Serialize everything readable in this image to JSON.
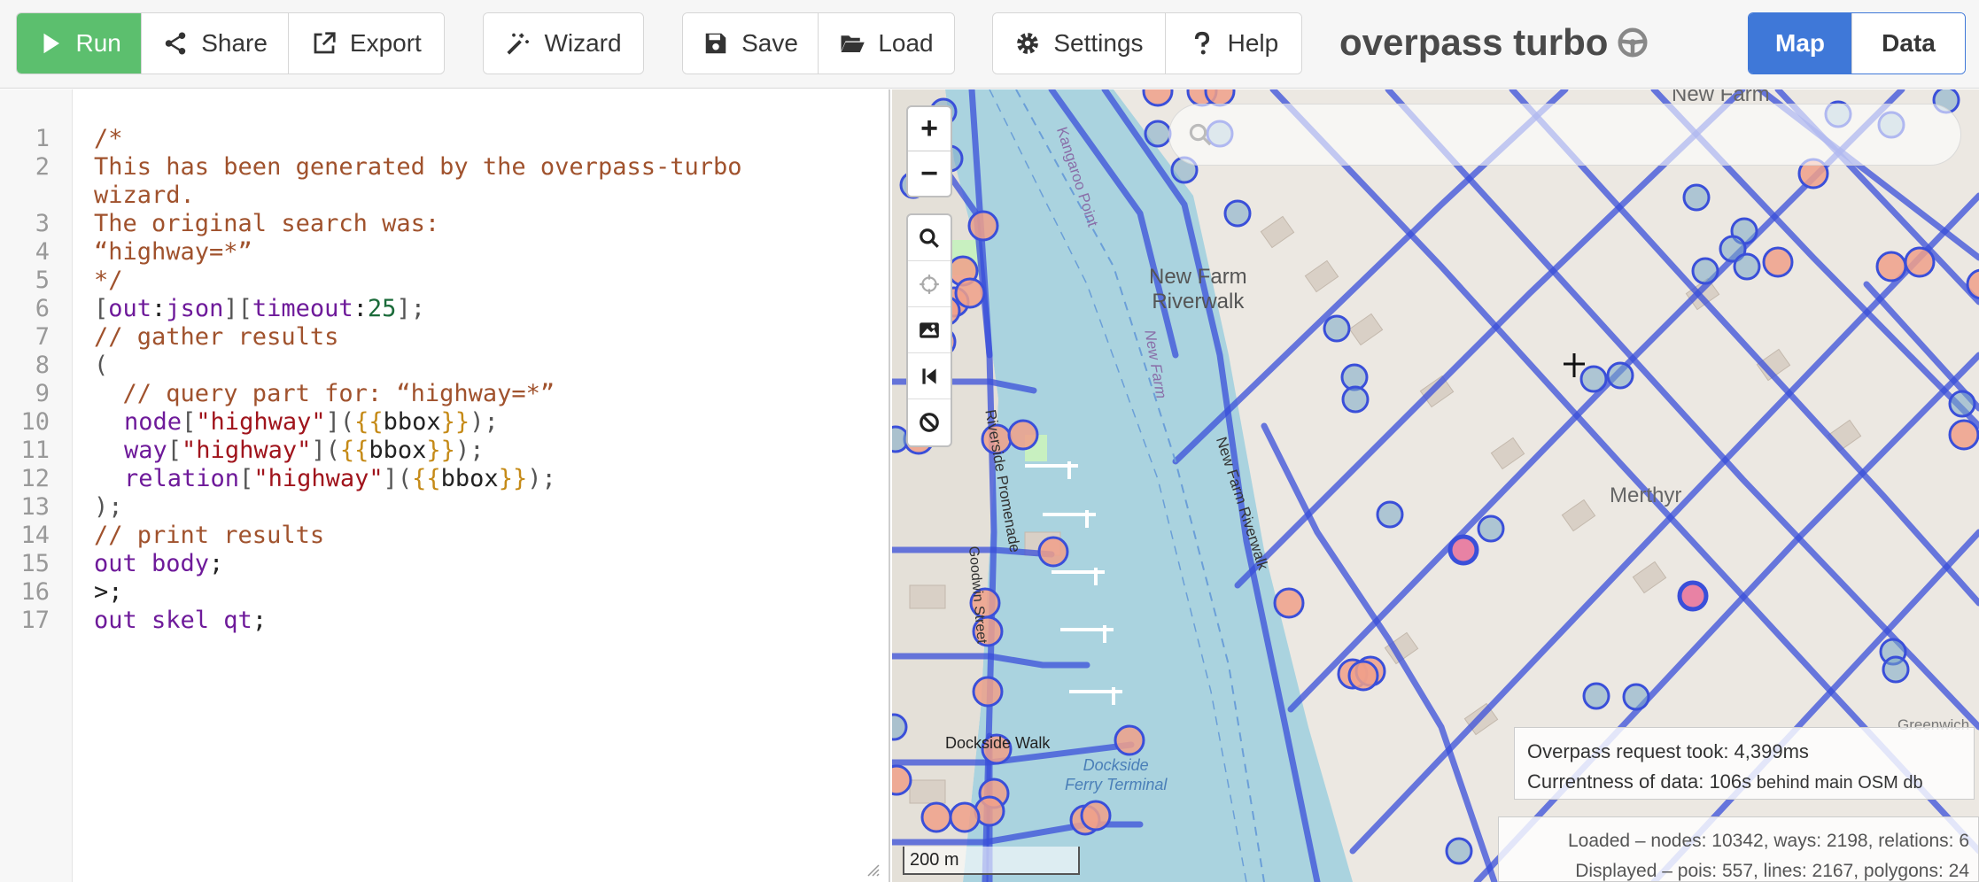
{
  "toolbar": {
    "run_label": "Run",
    "share_label": "Share",
    "export_label": "Export",
    "wizard_label": "Wizard",
    "save_label": "Save",
    "load_label": "Load",
    "settings_label": "Settings",
    "help_label": "Help",
    "app_title": "overpass turbo",
    "map_tab_label": "Map",
    "data_tab_label": "Data",
    "colors": {
      "run": "#5cbf6e",
      "map_tab": "#3f78d8"
    }
  },
  "editor": {
    "line_numbers": [
      "1",
      "2",
      "3",
      "4",
      "5",
      "6",
      "7",
      "8",
      "9",
      "10",
      "11",
      "12",
      "13",
      "14",
      "15",
      "16",
      "17"
    ],
    "lines": {
      "l1": "/*",
      "l2a": "This has been generated by the overpass-turbo",
      "l2b": "wizard.",
      "l3": "The original search was:",
      "l4": "“highway=*”",
      "l5": "*/",
      "l6_open": "[",
      "l6_out": "out",
      "l6_colon1": ":",
      "l6_json": "json",
      "l6_mid": "][",
      "l6_timeout": "timeout",
      "l6_colon2": ":",
      "l6_num": "25",
      "l6_close": "];",
      "l7": "// gather results",
      "l8": "(",
      "l9": "  // query part for: “highway=*”",
      "l10_kw": "node",
      "l11_kw": "way",
      "l12_kw": "relation",
      "key_open": "[",
      "key_str": "\"highway\"",
      "key_close": "](",
      "brace_open": "{{",
      "bbox": "bbox",
      "brace_close": "}}",
      "stmt_end": ");",
      "l13": ");",
      "l14": "// print results",
      "l15_kw": "out body",
      "l15_end": ";",
      "l16": ">;",
      "l17_kw": "out skel qt",
      "l17_end": ";"
    }
  },
  "map": {
    "zoom_in": "+",
    "zoom_out": "−",
    "search_placeholder": "",
    "scale": "200 m",
    "labels": {
      "new_farm_riverwalk": "New Farm",
      "new_farm_riverwalk2": "Riverwalk",
      "merthyr": "Merthyr",
      "new_farm": "New Farm",
      "riverside_promenade": "Riverside Promenade",
      "dockside_walk": "Dockside Walk",
      "dockside_ferry1": "Dockside",
      "dockside_ferry2": "Ferry Terminal",
      "new_farm_riverwalk_road": "New Farm Riverwalk",
      "kangaroo_point": "Kangaroo Point",
      "new_farm_vert": "New Farm",
      "goodwin_street": "Goodwin Street",
      "greenwich": "Greenwich"
    },
    "request_info": {
      "took": "Overpass request took: 4,399ms",
      "currentness_prefix": "Currentness of data: 106s",
      "currentness_suffix": " behind main OSM db"
    },
    "stats": {
      "loaded": "Loaded – nodes: 10342, ways: 2198, relations: 6",
      "displayed": "Displayed – pois: 557, lines: 2167, polygons: 24"
    }
  }
}
